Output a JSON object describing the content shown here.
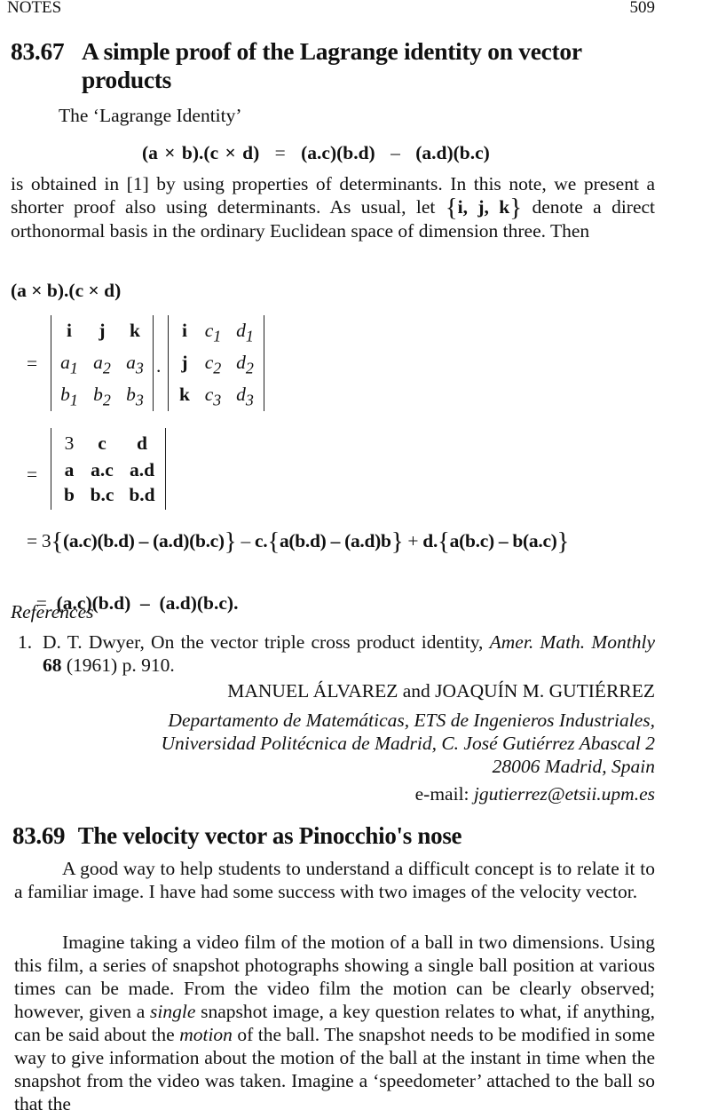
{
  "running_head": {
    "section": "NOTES",
    "page_number": "509"
  },
  "note1": {
    "number": "83.67",
    "title_line1": "A simple proof of the Lagrange identity on vector",
    "title_line2": "products",
    "intro": "The ‘Lagrange Identity’",
    "identity": {
      "lhs": "(a × b).(c × d)",
      "eq": "=",
      "rhs1": "(a.c)(b.d)",
      "minus": "–",
      "rhs2": "(a.d)(b.c)"
    },
    "paragraph_1": "is obtained in [1] by using properties of determinants.  In this note, we present a shorter proof also using determinants.  As usual, let",
    "basis_open": "{",
    "basis": "i, j, k",
    "basis_close": "}",
    "paragraph_1_end": "denote a direct orthonormal basis in the ordinary Euclidean space of dimension three. Then",
    "proof_lhs": "(a × b).(c × d)",
    "det_eq_1": "=",
    "det_dot": ".",
    "det1": [
      [
        "i",
        "j",
        "k"
      ],
      [
        "a1",
        "a2",
        "a3"
      ],
      [
        "b1",
        "b2",
        "b3"
      ]
    ],
    "det2": [
      [
        "i",
        "c1",
        "d1"
      ],
      [
        "j",
        "c2",
        "d2"
      ],
      [
        "k",
        "c3",
        "d3"
      ]
    ],
    "det_eq_2": "=",
    "det3": [
      [
        "3",
        "c",
        "d"
      ],
      [
        "a",
        "a.c",
        "a.d"
      ],
      [
        "b",
        "b.c",
        "b.d"
      ]
    ],
    "expansion": {
      "eq": "=",
      "part1_coef": "3",
      "part1": "(a.c)(b.d) – (a.d)(b.c)",
      "minus": "–",
      "part2_coef": "c.",
      "part2": "a(b.d) – (a.d)b",
      "plus": "+",
      "part3_coef": "d.",
      "part3": "a(b.c) – b(a.c)"
    },
    "result": {
      "eq": "=",
      "value": "(a.c)(b.d)  –  (a.d)(b.c)."
    },
    "references_heading": "References",
    "references": [
      {
        "number": "1.",
        "authors": "D. T. Dwyer, On the vector triple cross product identity,",
        "journal": "Amer. Math. Monthly",
        "volume": "68",
        "details": "(1961) p. 910."
      }
    ],
    "authors": "MANUEL ÁLVAREZ and JOAQUÍN  M. GUTIÉRREZ",
    "affiliation_line1": "Departamento de Matemáticas, ETS de Ingenieros Industriales,",
    "affiliation_line2": "Universidad Politécnica de Madrid, C. José Gutiérrez Abascal 2",
    "affiliation_line3": "28006 Madrid, Spain",
    "email_label": "e-mail:",
    "email": "jgutierrez@etsii.upm.es"
  },
  "note2": {
    "number": "83.69",
    "title": "The velocity vector as Pinocchio's nose",
    "paragraph_1": "A good way to help students to understand a difficult concept is to relate it to a familiar image. I have had some success with two images of the velocity vector.",
    "paragraph_2_a": "Imagine taking a video film of the motion of a ball in two dimensions. Using this film, a series of snapshot photographs showing a single ball position at various times can be made. From the video film the motion can be clearly observed; however, given a",
    "paragraph_2_em1": "single",
    "paragraph_2_b": "snapshot image, a key question relates to what, if anything, can be said about the",
    "paragraph_2_em2": "motion",
    "paragraph_2_c": "of the ball. The snapshot needs to be modified in some way to give information about the motion of the ball at the instant in time when the snapshot from the video was taken.  Imagine a ‘speedometer’ attached to the ball so that the"
  }
}
